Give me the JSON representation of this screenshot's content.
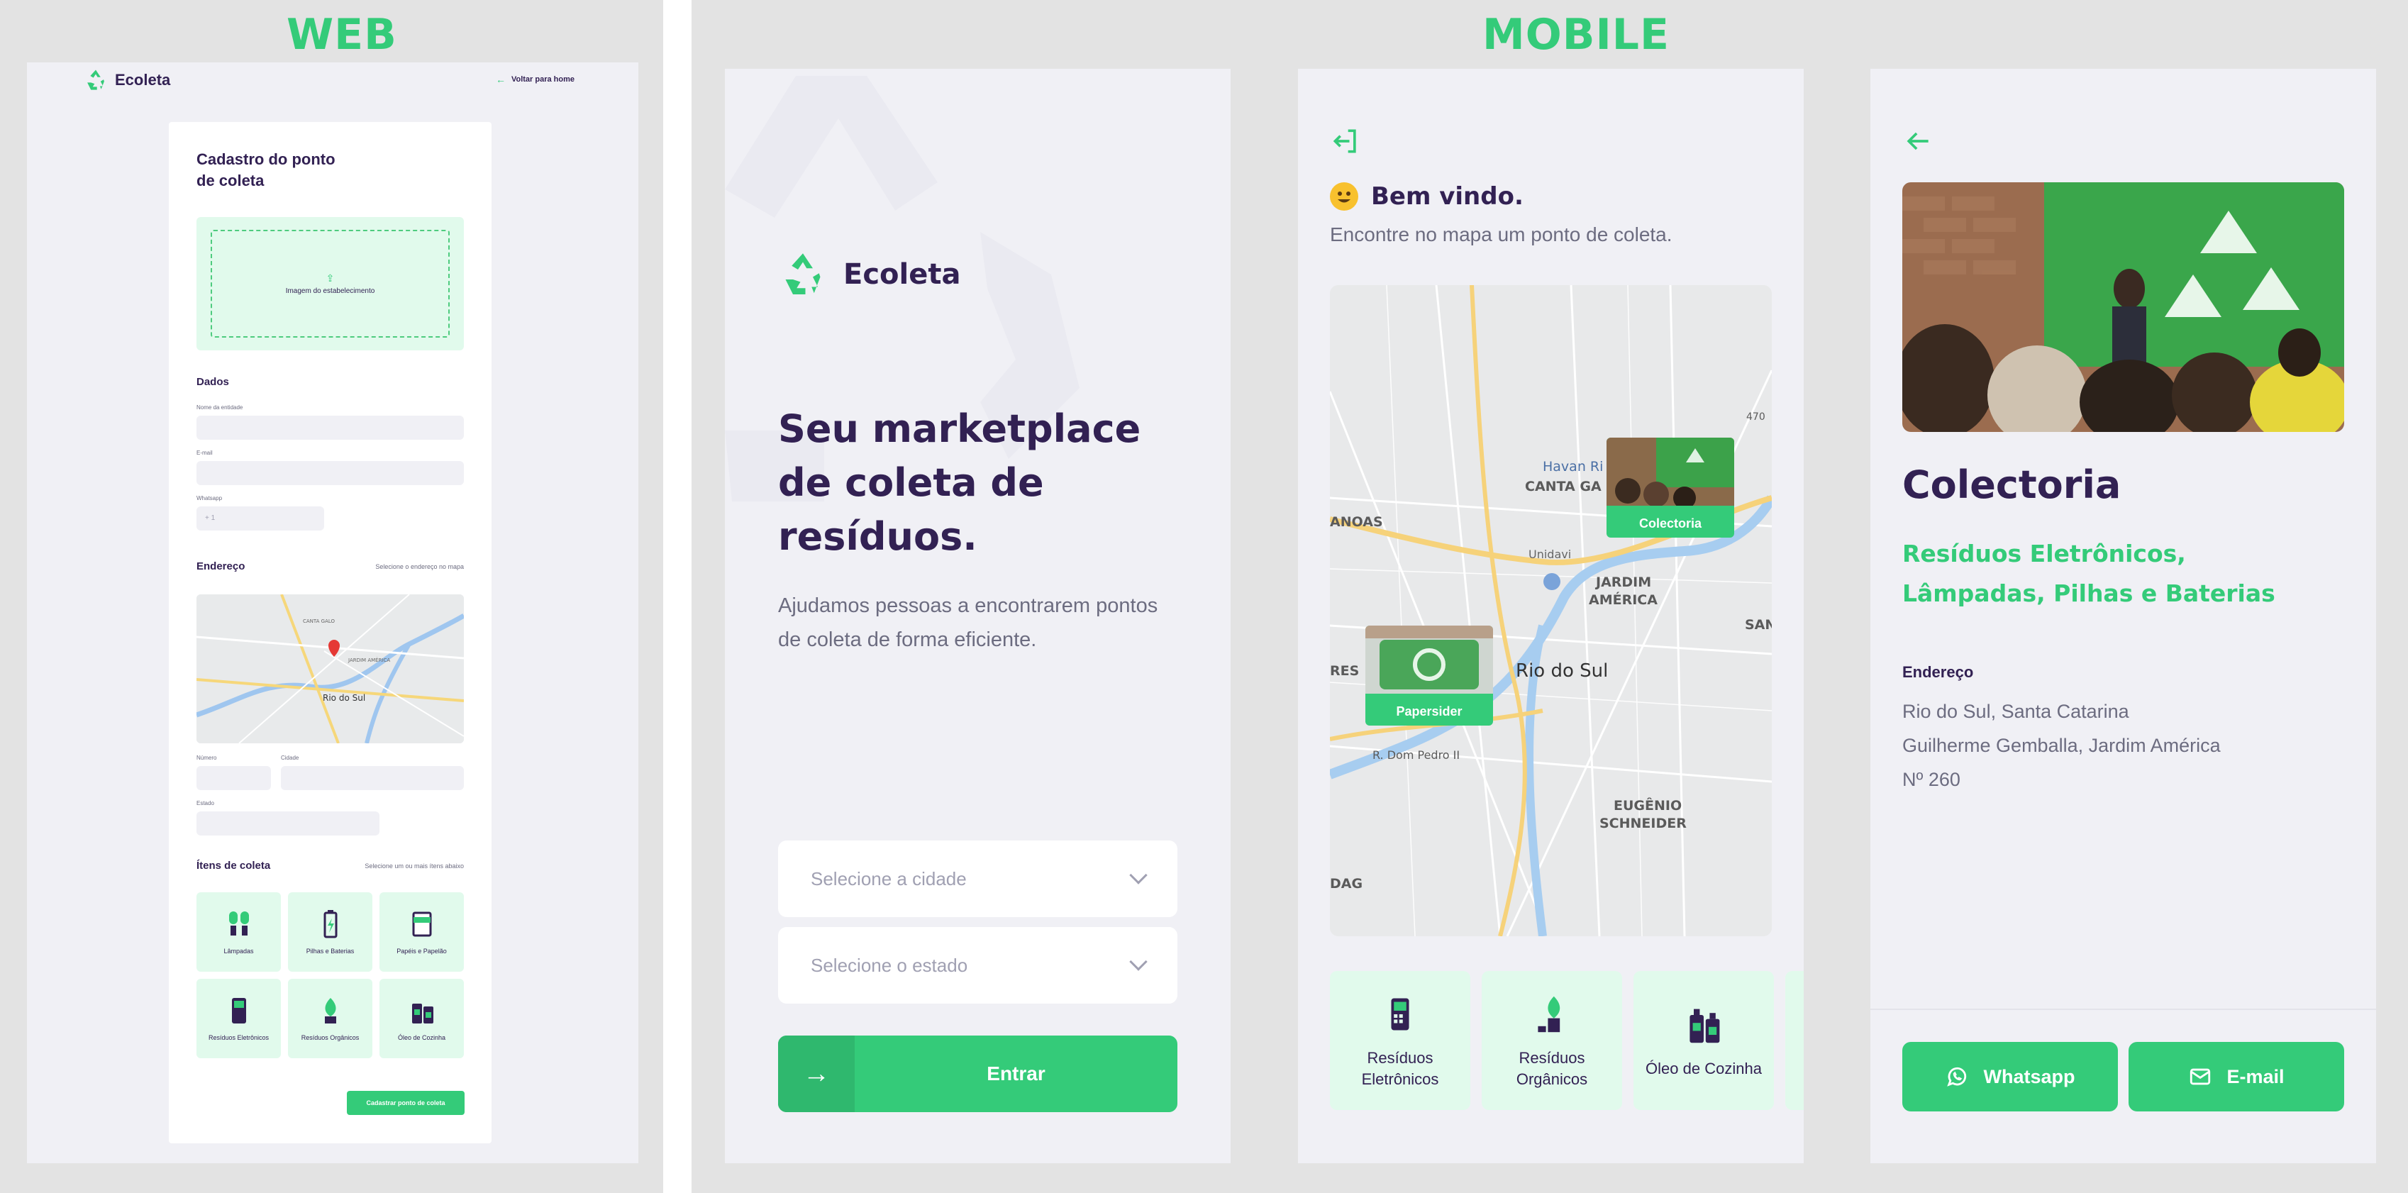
{
  "sections": {
    "web_label": "WEB",
    "mobile_label": "MOBILE"
  },
  "colors": {
    "accent": "#34cb79",
    "title": "#322153",
    "text": "#6c6c80",
    "bg": "#f0f0f5",
    "light_green": "#e1faec"
  },
  "web": {
    "brand": "Ecoleta",
    "back_link": "Voltar para home",
    "form": {
      "title": "Cadastro do ponto de coleta",
      "dropzone_text": "Imagem do estabelecimento",
      "dados": {
        "legend": "Dados",
        "name_label": "Nome da entidade",
        "email_label": "E-mail",
        "whatsapp_label": "Whatsapp",
        "whatsapp_value": "+ 1"
      },
      "endereco": {
        "legend": "Endereço",
        "hint": "Selecione o endereço no mapa",
        "number_label": "Número",
        "city_label": "Cidade",
        "state_label": "Estado",
        "map_labels": {
          "city": "Rio do Sul",
          "jardim": "JARDIM AMÉRICA",
          "canta": "CANTA GALO"
        }
      },
      "items": {
        "legend": "Ítens de coleta",
        "hint": "Selecione um ou mais ítens abaixo",
        "list": [
          {
            "label": "Lâmpadas",
            "icon": "lamp-icon"
          },
          {
            "label": "Pilhas e Baterias",
            "icon": "battery-icon"
          },
          {
            "label": "Papéis e Papelão",
            "icon": "paper-icon"
          },
          {
            "label": "Resíduos Eletrônicos",
            "icon": "electronics-icon"
          },
          {
            "label": "Resíduos Orgânicos",
            "icon": "organic-icon"
          },
          {
            "label": "Óleo de Cozinha",
            "icon": "oil-icon"
          }
        ]
      },
      "submit_label": "Cadastrar ponto de coleta"
    }
  },
  "mobile_home": {
    "brand": "Ecoleta",
    "headline": "Seu marketplace de coleta de resíduos.",
    "description": "Ajudamos pessoas a encontrarem pontos de coleta de forma eficiente.",
    "city_placeholder": "Selecione a cidade",
    "state_placeholder": "Selecione o estado",
    "enter_label": "Entrar"
  },
  "mobile_map": {
    "welcome": "Bem vindo.",
    "subtitle": "Encontre no mapa um ponto de coleta.",
    "map_labels": {
      "city": "Rio do Sul",
      "canta_galo": "CANTA GA",
      "havan": "Havan Ri",
      "jardim": "JARDIM",
      "america": "AMÉRICA",
      "eugenio": "EUGÊNIO",
      "schneider": "SCHNEIDER",
      "street": "R. Dom Pedro II",
      "unidavi": "Unidavi",
      "santa": "SANT",
      "anoas": "ANOAS",
      "res": "RES",
      "dag": "DAG",
      "road_470": "470"
    },
    "markers": [
      {
        "label": "Colectoria"
      },
      {
        "label": "Papersider"
      }
    ],
    "items": [
      {
        "label": "Resíduos Eletrônicos",
        "icon": "electronics-icon"
      },
      {
        "label": "Resíduos Orgânicos",
        "icon": "organic-icon"
      },
      {
        "label": "Óleo de Cozinha",
        "icon": "oil-icon"
      }
    ]
  },
  "mobile_detail": {
    "name": "Colectoria",
    "items": "Resíduos Eletrônicos, Lâmpadas, Pilhas e Baterias",
    "address_title": "Endereço",
    "address_line1": "Rio do Sul, Santa Catarina",
    "address_line2": "Guilherme Gemballa, Jardim América",
    "address_line3": "Nº 260",
    "whatsapp_label": "Whatsapp",
    "email_label": "E-mail"
  }
}
